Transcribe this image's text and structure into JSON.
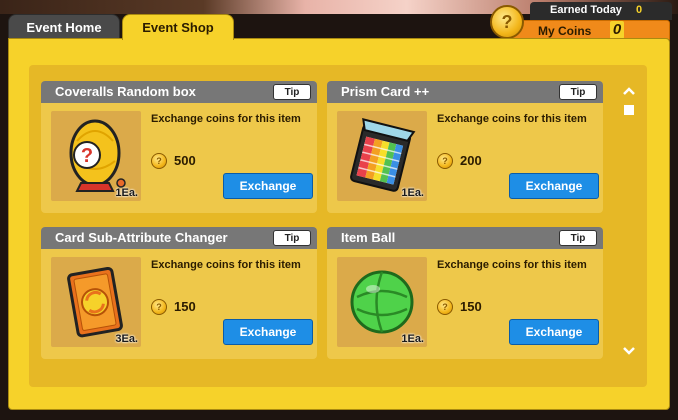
{
  "tabs": {
    "home": "Event Home",
    "shop": "Event Shop"
  },
  "coins": {
    "earned_label": "Earned Today",
    "earned_value": "0",
    "my_label": "My Coins",
    "my_value": "0",
    "icon": "coin-icon"
  },
  "items": [
    {
      "name": "Coveralls Random box",
      "tip": "Tip",
      "desc": "Exchange coins for this item",
      "price": "500",
      "qty": "1Ea.",
      "button": "Exchange",
      "icon": "mystery-bag-icon"
    },
    {
      "name": "Prism Card ++",
      "tip": "Tip",
      "desc": "Exchange coins for this item",
      "price": "200",
      "qty": "1Ea.",
      "button": "Exchange",
      "icon": "prism-card-icon"
    },
    {
      "name": "Card Sub-Attribute Changer",
      "tip": "Tip",
      "desc": "Exchange coins for this item",
      "price": "150",
      "qty": "3Ea.",
      "button": "Exchange",
      "icon": "attribute-changer-card-icon"
    },
    {
      "name": "Item Ball",
      "tip": "Tip",
      "desc": "Exchange coins for this item",
      "price": "150",
      "qty": "1Ea.",
      "button": "Exchange",
      "icon": "green-ball-icon"
    }
  ],
  "colors": {
    "accent": "#f6d22a",
    "button": "#1e8ee6",
    "header": "#777777",
    "coins_bar": "#f08a1a"
  }
}
